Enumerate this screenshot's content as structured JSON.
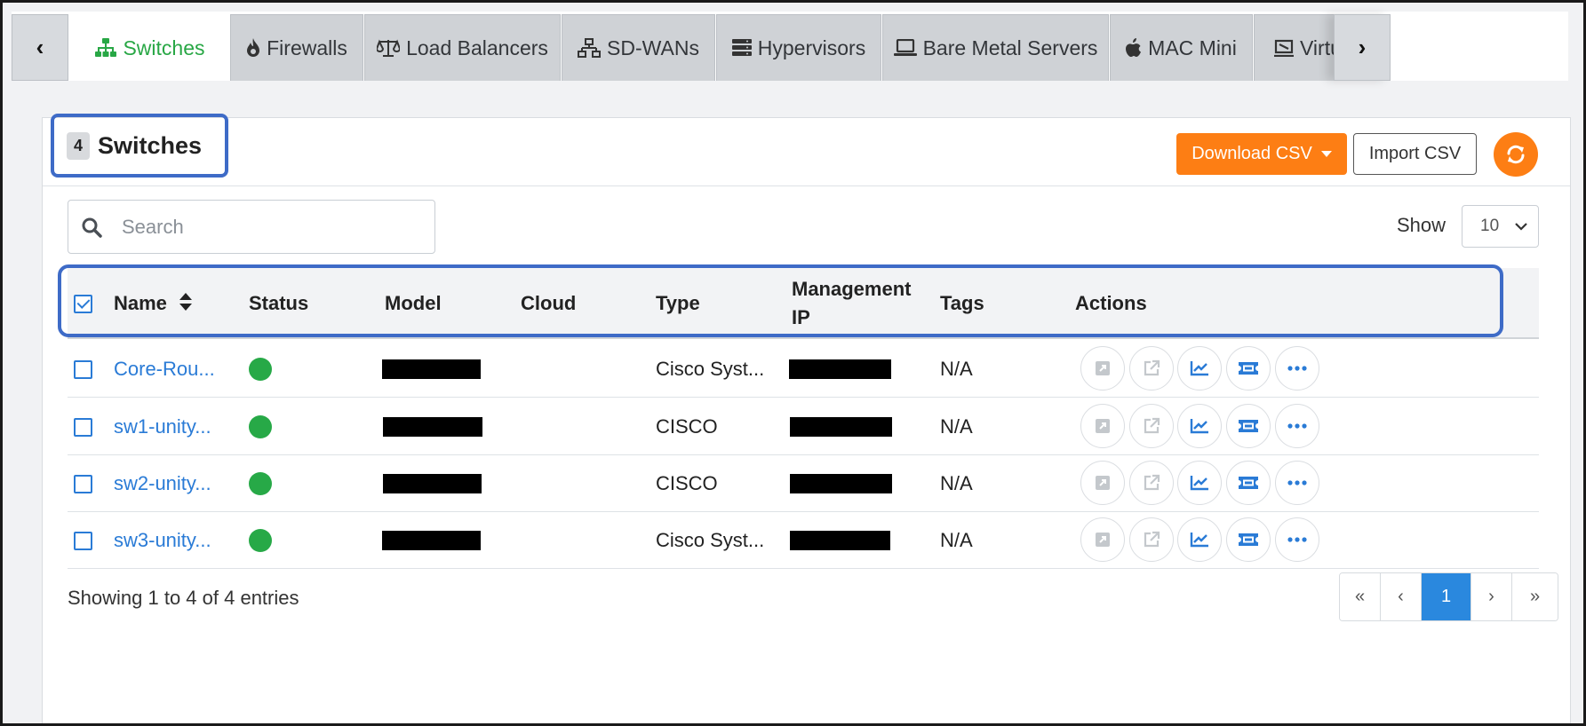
{
  "tabs": [
    {
      "label": "Switches",
      "icon": "sitemap-icon",
      "active": true
    },
    {
      "label": "Firewalls",
      "icon": "fire-icon",
      "active": false
    },
    {
      "label": "Load Balancers",
      "icon": "balance-scale-icon",
      "active": false
    },
    {
      "label": "SD-WANs",
      "icon": "network-icon",
      "active": false
    },
    {
      "label": "Hypervisors",
      "icon": "server-icon",
      "active": false
    },
    {
      "label": "Bare Metal Servers",
      "icon": "laptop-icon",
      "active": false
    },
    {
      "label": "MAC Mini",
      "icon": "apple-icon",
      "active": false
    },
    {
      "label": "Virtu",
      "icon": "virtual-icon",
      "active": false
    }
  ],
  "tab_scroll": {
    "left": "‹",
    "right": "›"
  },
  "header": {
    "count": "4",
    "title": "Switches",
    "download_label": "Download CSV",
    "import_label": "Import CSV"
  },
  "search": {
    "placeholder": "Search",
    "value": ""
  },
  "show": {
    "label": "Show",
    "value": "10"
  },
  "table": {
    "columns": {
      "name": "Name",
      "status": "Status",
      "model": "Model",
      "cloud": "Cloud",
      "type": "Type",
      "management_ip_1": "Management",
      "management_ip_2": "IP",
      "tags": "Tags",
      "actions": "Actions"
    },
    "rows": [
      {
        "name": "Core-Rou...",
        "status": "online",
        "type": "Cisco Syst...",
        "tags": "N/A"
      },
      {
        "name": "sw1-unity...",
        "status": "online",
        "type": "CISCO",
        "tags": "N/A"
      },
      {
        "name": "sw2-unity...",
        "status": "online",
        "type": "CISCO",
        "tags": "N/A"
      },
      {
        "name": "sw3-unity...",
        "status": "online",
        "type": "Cisco Syst...",
        "tags": "N/A"
      }
    ],
    "row_actions": [
      "resize-icon",
      "external-link-icon",
      "chart-line-icon",
      "ticket-icon",
      "ellipsis-icon"
    ]
  },
  "footer": {
    "showing": "Showing 1 to 4 of 4 entries",
    "pager": {
      "first": "«",
      "prev": "‹",
      "current": "1",
      "next": "›",
      "last": "»"
    }
  },
  "colors": {
    "accent_green": "#28a745",
    "link_blue": "#2a7bd6",
    "orange": "#fd7e14",
    "highlight_outline": "#3e6bc7",
    "status_online": "#27a947"
  }
}
